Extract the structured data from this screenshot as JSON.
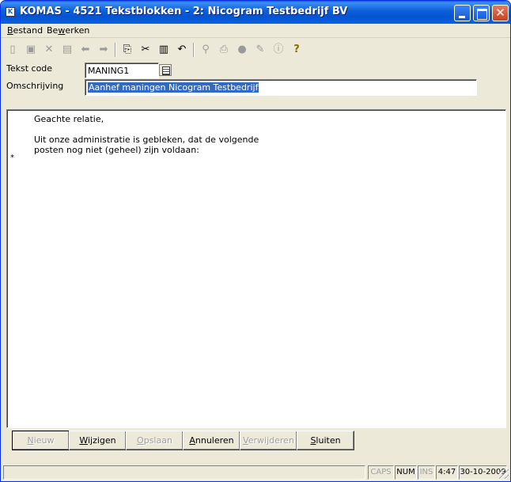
{
  "window": {
    "title": "KOMAS - 4521 Tekstblokken - 2: Nicogram Testbedrijf BV",
    "app_icon": "komas-app-icon"
  },
  "menu": {
    "items": [
      {
        "label": "Bestand",
        "mnemonic": "B"
      },
      {
        "label": "Bewerken",
        "mnemonic": "w"
      }
    ]
  },
  "toolbar": {
    "tools": [
      {
        "name": "new-icon",
        "glyph": "🗋",
        "enabled": false
      },
      {
        "name": "save-icon",
        "glyph": "💾",
        "enabled": false
      },
      {
        "name": "delete-icon",
        "glyph": "✕",
        "enabled": false
      },
      {
        "name": "save-close-icon",
        "glyph": "▤",
        "enabled": false
      },
      {
        "name": "previous-icon",
        "glyph": "⬅",
        "enabled": false
      },
      {
        "name": "next-icon",
        "glyph": "➡",
        "enabled": false
      },
      {
        "name": "copy-icon",
        "glyph": "⎘",
        "enabled": true
      },
      {
        "name": "cut-icon",
        "glyph": "✂",
        "enabled": true
      },
      {
        "name": "paste-icon",
        "glyph": "📋",
        "enabled": true
      },
      {
        "name": "undo-icon",
        "glyph": "↶",
        "enabled": true
      },
      {
        "name": "find-icon",
        "glyph": "⚲",
        "enabled": false
      },
      {
        "name": "print-icon",
        "glyph": "⎙",
        "enabled": false
      },
      {
        "name": "stamp-icon",
        "glyph": "●",
        "enabled": false
      },
      {
        "name": "edit-icon",
        "glyph": "✎",
        "enabled": false
      },
      {
        "name": "info-icon",
        "glyph": "ⓘ",
        "enabled": false
      },
      {
        "name": "help-icon",
        "glyph": "?",
        "enabled": true
      }
    ]
  },
  "form": {
    "code_label": "Tekst code",
    "code_value": "MANING1",
    "desc_label": "Omschrijving",
    "desc_value": "Aanhef maningen Nicogram Testbedrijf"
  },
  "editor": {
    "lines": [
      "Geachte relatie,",
      "",
      "Uit onze administratie is gebleken, dat de volgende",
      "posten nog niet (geheel) zijn voldaan:"
    ],
    "marker": "*"
  },
  "buttons": [
    {
      "label": "Nieuw",
      "mnemonic": "N",
      "enabled": false
    },
    {
      "label": "Wijzigen",
      "mnemonic": "W",
      "enabled": true
    },
    {
      "label": "Opslaan",
      "mnemonic": "O",
      "enabled": false
    },
    {
      "label": "Annuleren",
      "mnemonic": "A",
      "enabled": true
    },
    {
      "label": "Verwijderen",
      "mnemonic": "V",
      "enabled": false
    },
    {
      "label": "Sluiten",
      "mnemonic": "S",
      "enabled": true
    }
  ],
  "status": {
    "caps": "CAPS",
    "num": "NUM",
    "ins": "INS",
    "time": "4:47",
    "date": "30-10-2009"
  }
}
